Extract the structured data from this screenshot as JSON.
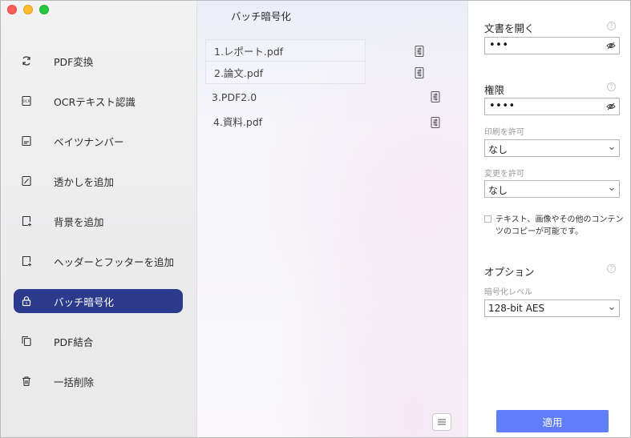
{
  "sidebar": {
    "items": [
      {
        "label": "PDF変換",
        "icon": "convert-icon"
      },
      {
        "label": "OCRテキスト認識",
        "icon": "ocr-icon"
      },
      {
        "label": "ベイツナンバー",
        "icon": "bates-icon"
      },
      {
        "label": "透かしを追加",
        "icon": "watermark-icon"
      },
      {
        "label": "背景を追加",
        "icon": "background-icon"
      },
      {
        "label": "ヘッダーとフッターを追加",
        "icon": "header-footer-icon"
      },
      {
        "label": "バッチ暗号化",
        "icon": "lock-icon"
      },
      {
        "label": "PDF結合",
        "icon": "combine-icon"
      },
      {
        "label": "一括削除",
        "icon": "trash-icon"
      }
    ]
  },
  "main": {
    "title": "バッチ暗号化",
    "files": [
      {
        "name": "1.レポート.pdf"
      },
      {
        "name": "2.論文.pdf"
      },
      {
        "name": "3.PDF2.0"
      },
      {
        "name": "4.資料.pdf"
      }
    ]
  },
  "panel": {
    "open_doc": {
      "title": "文書を開く",
      "password": "•••"
    },
    "permissions": {
      "title": "権限",
      "password": "••••",
      "print_label": "印刷を許可",
      "print_value": "なし",
      "change_label": "変更を許可",
      "change_value": "なし",
      "copy_text": "テキスト、画像やその他のコンテンツのコピーが可能です。"
    },
    "options": {
      "title": "オプション",
      "level_label": "暗号化レベル",
      "level_value": "128-bit AES"
    },
    "apply_label": "適用",
    "help_glyph": "?"
  },
  "colors": {
    "active_nav": "#2b3a8c",
    "apply_button": "#5f7ef7"
  }
}
